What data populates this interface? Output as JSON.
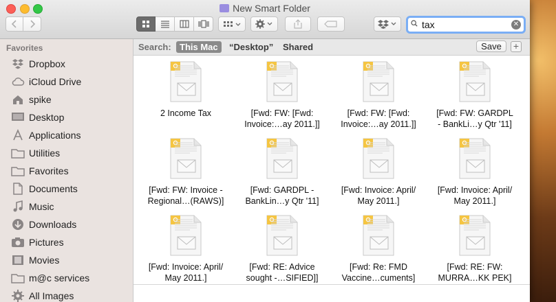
{
  "window": {
    "title": "New Smart Folder"
  },
  "toolbar": {
    "search": {
      "value": "tax"
    }
  },
  "sidebar": {
    "heading": "Favorites",
    "items": [
      {
        "label": "Dropbox",
        "icon": "dropbox-icon"
      },
      {
        "label": "iCloud Drive",
        "icon": "cloud-icon"
      },
      {
        "label": "spike",
        "icon": "home-icon"
      },
      {
        "label": "Desktop",
        "icon": "desktop-icon"
      },
      {
        "label": "Applications",
        "icon": "applications-icon"
      },
      {
        "label": "Utilities",
        "icon": "folder-icon"
      },
      {
        "label": "Favorites",
        "icon": "folder-icon"
      },
      {
        "label": "Documents",
        "icon": "documents-icon"
      },
      {
        "label": "Music",
        "icon": "music-icon"
      },
      {
        "label": "Downloads",
        "icon": "downloads-icon"
      },
      {
        "label": "Pictures",
        "icon": "pictures-icon"
      },
      {
        "label": "Movies",
        "icon": "movies-icon"
      },
      {
        "label": "m@c services",
        "icon": "folder-icon"
      },
      {
        "label": "All Images",
        "icon": "gear-icon"
      }
    ]
  },
  "searchbar": {
    "label": "Search:",
    "scopes": [
      "This Mac",
      "“Desktop”",
      "Shared"
    ],
    "active_scope": "This Mac",
    "save_label": "Save",
    "add_label": "+"
  },
  "files": [
    {
      "name": "2   Income Tax"
    },
    {
      "name": "[Fwd: FW: [Fwd:\nInvoice:…ay 2011.]]"
    },
    {
      "name": "[Fwd: FW: [Fwd:\nInvoice:…ay 2011.]]"
    },
    {
      "name": "[Fwd: FW: GARDPL\n- BankLi…y Qtr '11]"
    },
    {
      "name": "[Fwd: FW: Invoice -\nRegional…(RAWS)]"
    },
    {
      "name": "[Fwd: GARDPL -\nBankLin…y Qtr '11]"
    },
    {
      "name": "[Fwd: Invoice: April/\nMay 2011.]"
    },
    {
      "name": "[Fwd: Invoice: April/\nMay 2011.]"
    },
    {
      "name": "[Fwd: Invoice: April/\nMay 2011.]"
    },
    {
      "name": "[Fwd: RE: Advice\nsought -…SIFIED]]"
    },
    {
      "name": "[Fwd: Re: FMD\nVaccine…cuments]"
    },
    {
      "name": "[Fwd: RE: FW:\nMURRA…KK PEK]"
    }
  ]
}
